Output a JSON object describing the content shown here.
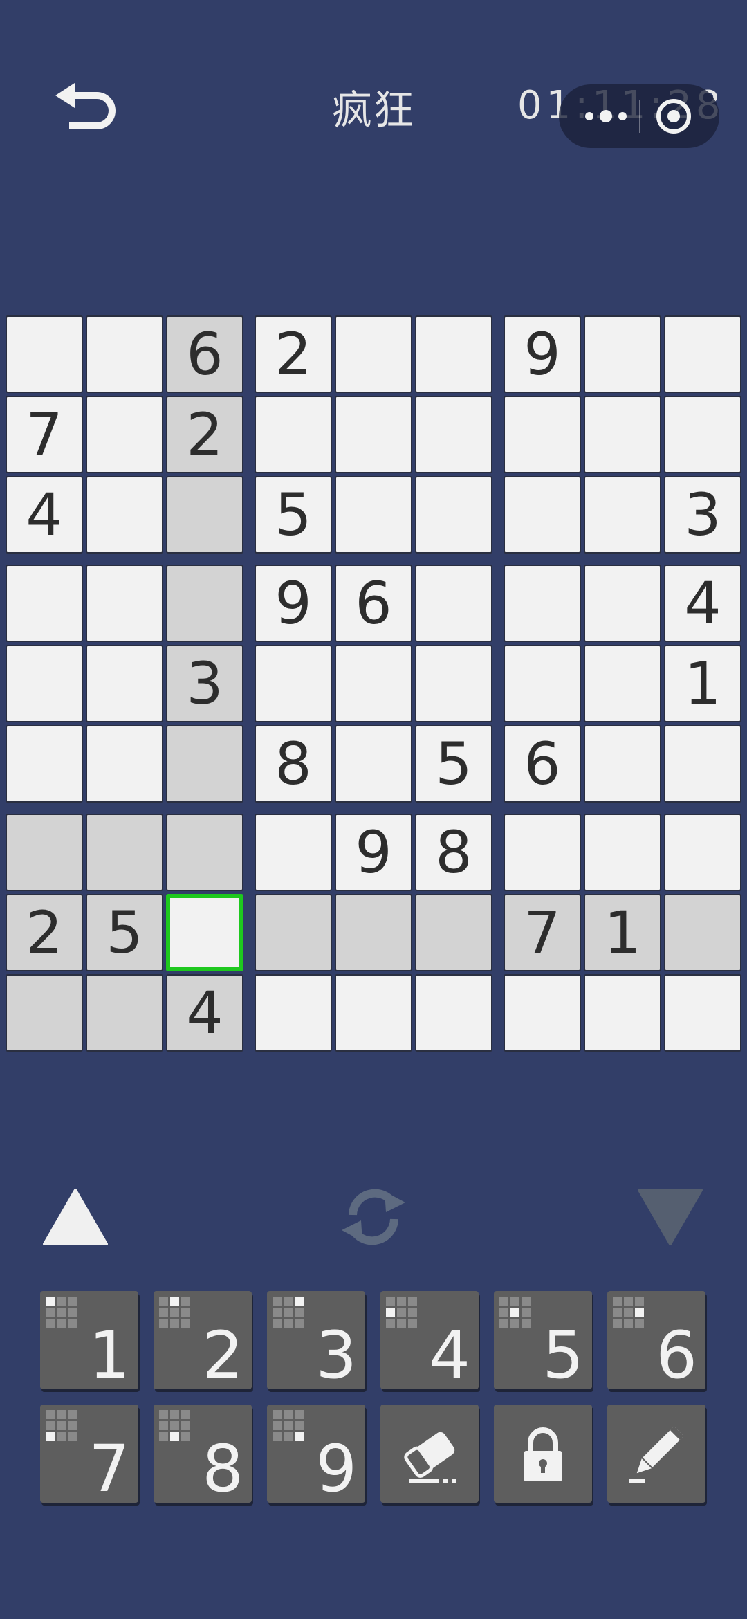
{
  "header": {
    "back_icon": "back-arrow-icon",
    "title": "疯狂",
    "timer": "01:11:28",
    "menu_icon": "more-dots-icon",
    "close_icon": "target-circle-icon"
  },
  "board": {
    "rows": [
      [
        "",
        "",
        "6",
        "2",
        "",
        "",
        "9",
        "",
        ""
      ],
      [
        "7",
        "",
        "2",
        "",
        "",
        "",
        "",
        "",
        ""
      ],
      [
        "4",
        "",
        "",
        "5",
        "",
        "",
        "",
        "",
        "3"
      ],
      [
        "",
        "",
        "",
        "9",
        "6",
        "",
        "",
        "",
        "4"
      ],
      [
        "",
        "",
        "3",
        "",
        "",
        "",
        "",
        "",
        "1"
      ],
      [
        "",
        "",
        "",
        "8",
        "",
        "5",
        "6",
        "",
        ""
      ],
      [
        "",
        "",
        "",
        "",
        "9",
        "8",
        "",
        "",
        ""
      ],
      [
        "2",
        "5",
        "",
        "",
        "",
        "",
        "7",
        "1",
        ""
      ],
      [
        "",
        "",
        "4",
        "",
        "",
        "",
        "",
        "",
        ""
      ]
    ],
    "selected_cell": {
      "row": 7,
      "col": 2
    },
    "highlight_color": "#d3d3d3",
    "cell_color": "#f2f2f2",
    "selection_color": "#1ec81e"
  },
  "controls": {
    "up_icon": "triangle-up-icon",
    "refresh_icon": "refresh-icon",
    "down_icon": "triangle-down-icon"
  },
  "keypad": {
    "digits": [
      "1",
      "2",
      "3",
      "4",
      "5",
      "6",
      "7",
      "8",
      "9"
    ],
    "tools": [
      "eraser-icon",
      "lock-icon",
      "pencil-icon"
    ]
  },
  "colors": {
    "background": "#323e68",
    "key": "#5e5e5e",
    "text_light": "#e6e6e6"
  }
}
